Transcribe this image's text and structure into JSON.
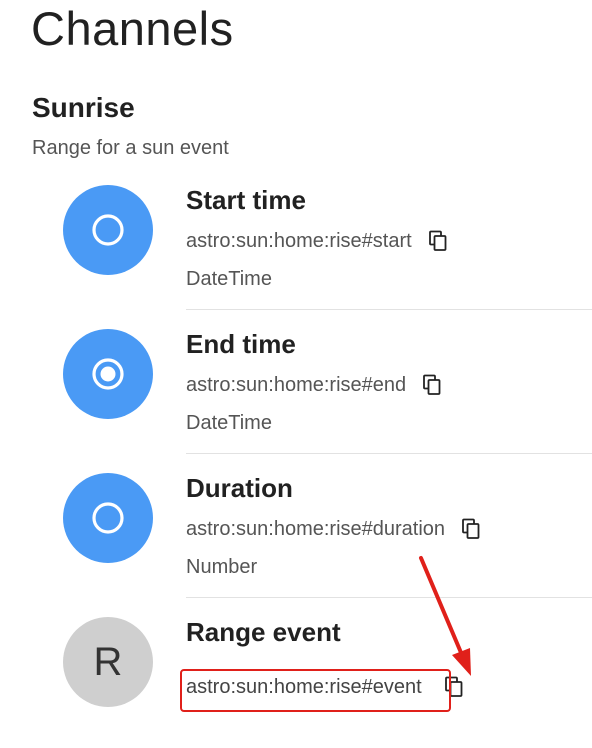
{
  "page": {
    "title": "Channels"
  },
  "group": {
    "title": "Sunrise",
    "description": "Range for a sun event"
  },
  "channels": [
    {
      "name": "Start time",
      "uid": "astro:sun:home:rise#start",
      "type": "DateTime",
      "icon": "radio-unchecked-icon"
    },
    {
      "name": "End time",
      "uid": "astro:sun:home:rise#end",
      "type": "DateTime",
      "icon": "radio-checked-icon"
    },
    {
      "name": "Duration",
      "uid": "astro:sun:home:rise#duration",
      "type": "Number",
      "icon": "radio-unchecked-icon"
    },
    {
      "name": "Range event",
      "uid": "astro:sun:home:rise#event",
      "type": "",
      "avatar_letter": "R"
    }
  ],
  "colors": {
    "avatar_blue": "#4a9af5",
    "avatar_grey": "#cfcfcf",
    "annotation_red": "#e0201a"
  }
}
